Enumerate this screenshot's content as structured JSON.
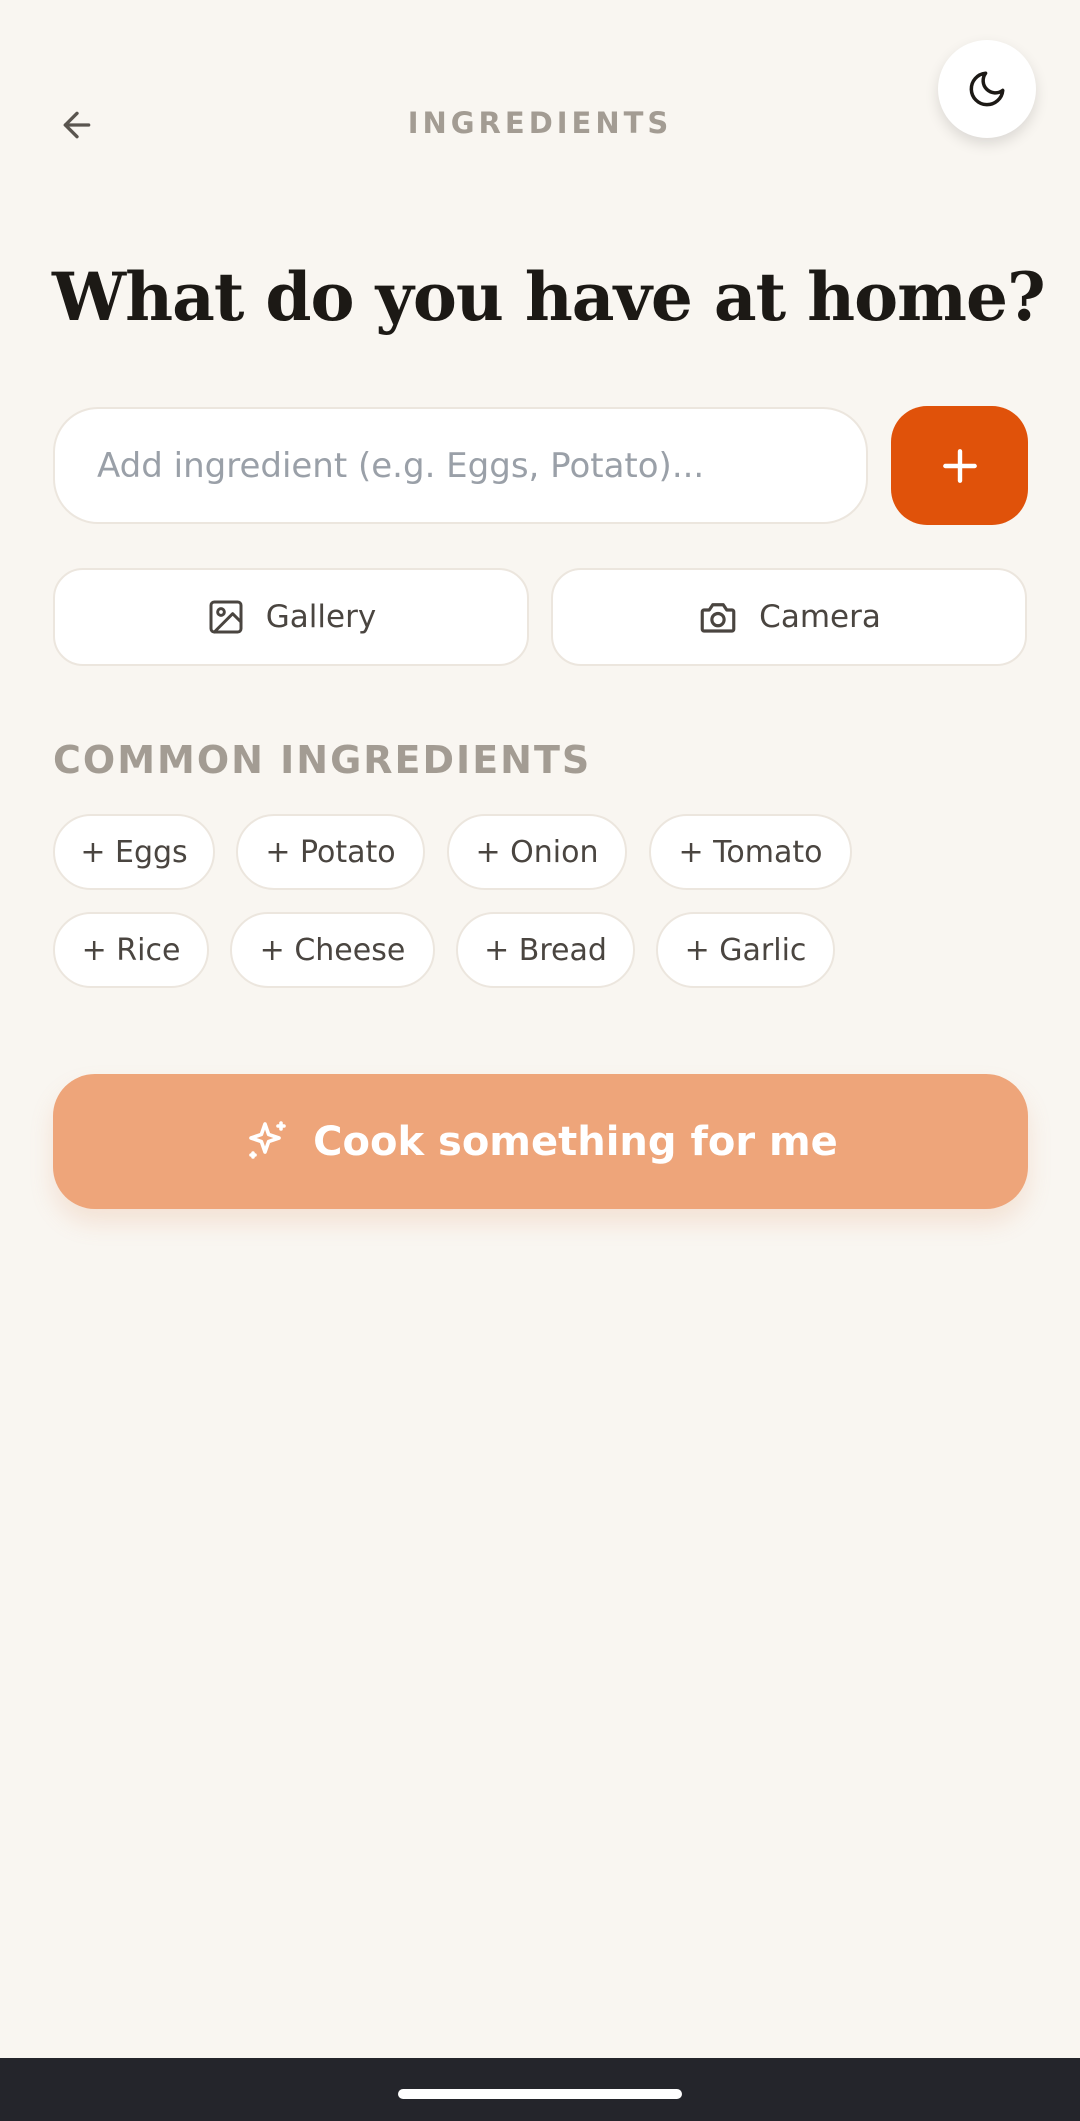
{
  "header": {
    "title": "INGREDIENTS",
    "back_icon": "arrow-left-icon",
    "theme_icon": "moon-icon"
  },
  "main": {
    "heading": "What do you have at home?",
    "input": {
      "value": "",
      "placeholder": "Add ingredient (e.g. Eggs, Potato)..."
    },
    "add_icon": "plus-icon",
    "gallery_label": "Gallery",
    "camera_label": "Camera"
  },
  "common": {
    "label": "COMMON INGREDIENTS",
    "chips": [
      "+ Eggs",
      "+ Potato",
      "+ Onion",
      "+ Tomato",
      "+ Rice",
      "+ Cheese",
      "+ Bread",
      "+ Garlic"
    ]
  },
  "cta": {
    "label": "Cook something for me",
    "icon": "sparkle-icon"
  },
  "colors": {
    "background": "#f9f6f1",
    "accent": "#e0520a",
    "cta": "#eea57a",
    "muted_text": "#a39c93",
    "nav_bar": "#24252b"
  }
}
